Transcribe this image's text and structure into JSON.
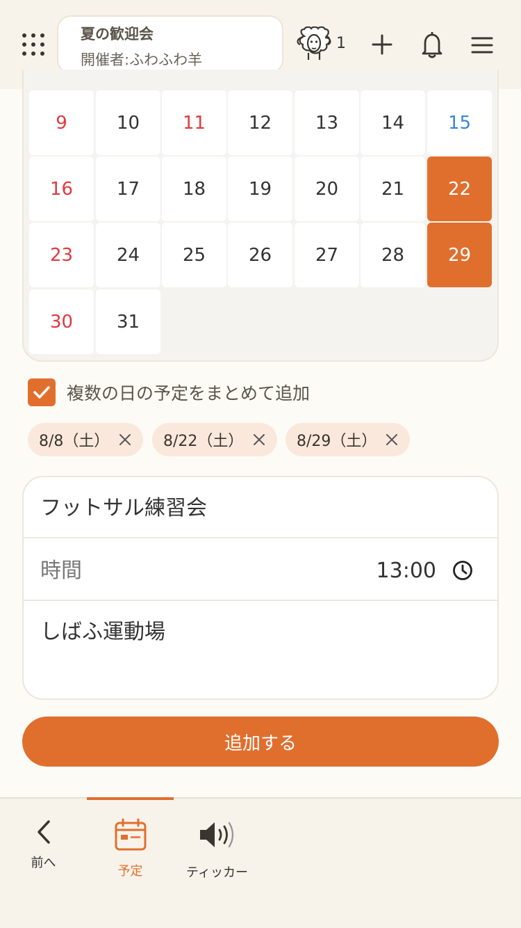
{
  "header": {
    "event_title": "夏の歓迎会",
    "event_host": "開催者:ふわふわ羊",
    "member_count": "1",
    "icons": [
      "grid-menu-icon",
      "sheep-icon",
      "plus-icon",
      "bell-icon",
      "hamburger-menu-icon"
    ]
  },
  "calendar": {
    "weeks": [
      [
        {
          "day": "9",
          "type": "sun",
          "selected": false
        },
        {
          "day": "10",
          "type": "weekday",
          "selected": false
        },
        {
          "day": "11",
          "type": "sun",
          "selected": false
        },
        {
          "day": "12",
          "type": "weekday",
          "selected": false
        },
        {
          "day": "13",
          "type": "weekday",
          "selected": false
        },
        {
          "day": "14",
          "type": "weekday",
          "selected": false
        },
        {
          "day": "15",
          "type": "sat",
          "selected": false
        }
      ],
      [
        {
          "day": "16",
          "type": "sun",
          "selected": false
        },
        {
          "day": "17",
          "type": "weekday",
          "selected": false
        },
        {
          "day": "18",
          "type": "weekday",
          "selected": false
        },
        {
          "day": "19",
          "type": "weekday",
          "selected": false
        },
        {
          "day": "20",
          "type": "weekday",
          "selected": false
        },
        {
          "day": "21",
          "type": "weekday",
          "selected": false
        },
        {
          "day": "22",
          "type": "sat",
          "selected": true
        }
      ],
      [
        {
          "day": "23",
          "type": "sun",
          "selected": false
        },
        {
          "day": "24",
          "type": "weekday",
          "selected": false
        },
        {
          "day": "25",
          "type": "weekday",
          "selected": false
        },
        {
          "day": "26",
          "type": "weekday",
          "selected": false
        },
        {
          "day": "27",
          "type": "weekday",
          "selected": false
        },
        {
          "day": "28",
          "type": "weekday",
          "selected": false
        },
        {
          "day": "29",
          "type": "sat",
          "selected": true
        }
      ],
      [
        {
          "day": "30",
          "type": "sun",
          "selected": false
        },
        {
          "day": "31",
          "type": "weekday",
          "selected": false
        }
      ]
    ],
    "colors": {
      "sunday": "#e0393f",
      "saturday": "#3a86d6",
      "selected": "#e06f2e"
    }
  },
  "multi_day": {
    "checked": true,
    "label": "複数の日の予定をまとめて追加"
  },
  "selected_dates": [
    {
      "label": "8/8（土）"
    },
    {
      "label": "8/22（土）"
    },
    {
      "label": "8/29（土）"
    }
  ],
  "form": {
    "title": "フットサル練習会",
    "time_label": "時間",
    "time_value": "13:00",
    "place": "しばふ運動場"
  },
  "add_button": {
    "label": "追加する"
  },
  "bottom_nav": {
    "items": [
      {
        "label": "前へ",
        "icon": "chevron-left-icon",
        "active": false
      },
      {
        "label": "予定",
        "icon": "calendar-icon",
        "active": true
      },
      {
        "label": "ティッカー",
        "icon": "speaker-icon",
        "active": false
      }
    ]
  },
  "accent_color": "#e06f2e"
}
